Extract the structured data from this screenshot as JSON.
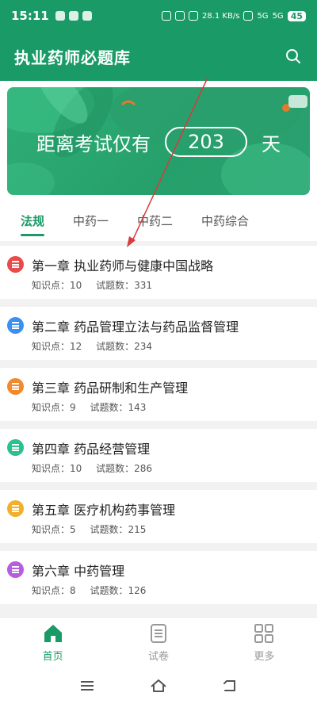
{
  "status_bar": {
    "time": "15:11",
    "network": "28.1 KB/s",
    "signal1": "5G",
    "signal2": "5G",
    "battery": "45"
  },
  "header": {
    "title": "执业药师必题库"
  },
  "banner": {
    "prefix": "距离考试仅有",
    "days": "203",
    "suffix": "天"
  },
  "tabs": [
    {
      "label": "法规",
      "active": true
    },
    {
      "label": "中药一",
      "active": false
    },
    {
      "label": "中药二",
      "active": false
    },
    {
      "label": "中药综合",
      "active": false
    }
  ],
  "chapters": [
    {
      "title": "第一章  执业药师与健康中国战略",
      "points_label": "知识点：10",
      "questions_label": "试题数：331",
      "color": "#e84b4b"
    },
    {
      "title": "第二章  药品管理立法与药品监督管理",
      "points_label": "知识点：12",
      "questions_label": "试题数：234",
      "color": "#3a8ff0"
    },
    {
      "title": "第三章  药品研制和生产管理",
      "points_label": "知识点：9",
      "questions_label": "试题数：143",
      "color": "#f08a2c"
    },
    {
      "title": "第四章  药品经营管理",
      "points_label": "知识点：10",
      "questions_label": "试题数：286",
      "color": "#2cc08a"
    },
    {
      "title": "第五章   医疗机构药事管理",
      "points_label": "知识点：5",
      "questions_label": "试题数：215",
      "color": "#f0b02c"
    },
    {
      "title": "第六章  中药管理",
      "points_label": "知识点：8",
      "questions_label": "试题数：126",
      "color": "#b65ee0"
    }
  ],
  "bottom_nav": [
    {
      "label": "首页",
      "icon": "home-icon",
      "active": true
    },
    {
      "label": "试卷",
      "icon": "paper-icon",
      "active": false
    },
    {
      "label": "更多",
      "icon": "grid-icon",
      "active": false
    }
  ],
  "colors": {
    "brand": "#1a9a66",
    "annotation": "#d93a3a"
  }
}
